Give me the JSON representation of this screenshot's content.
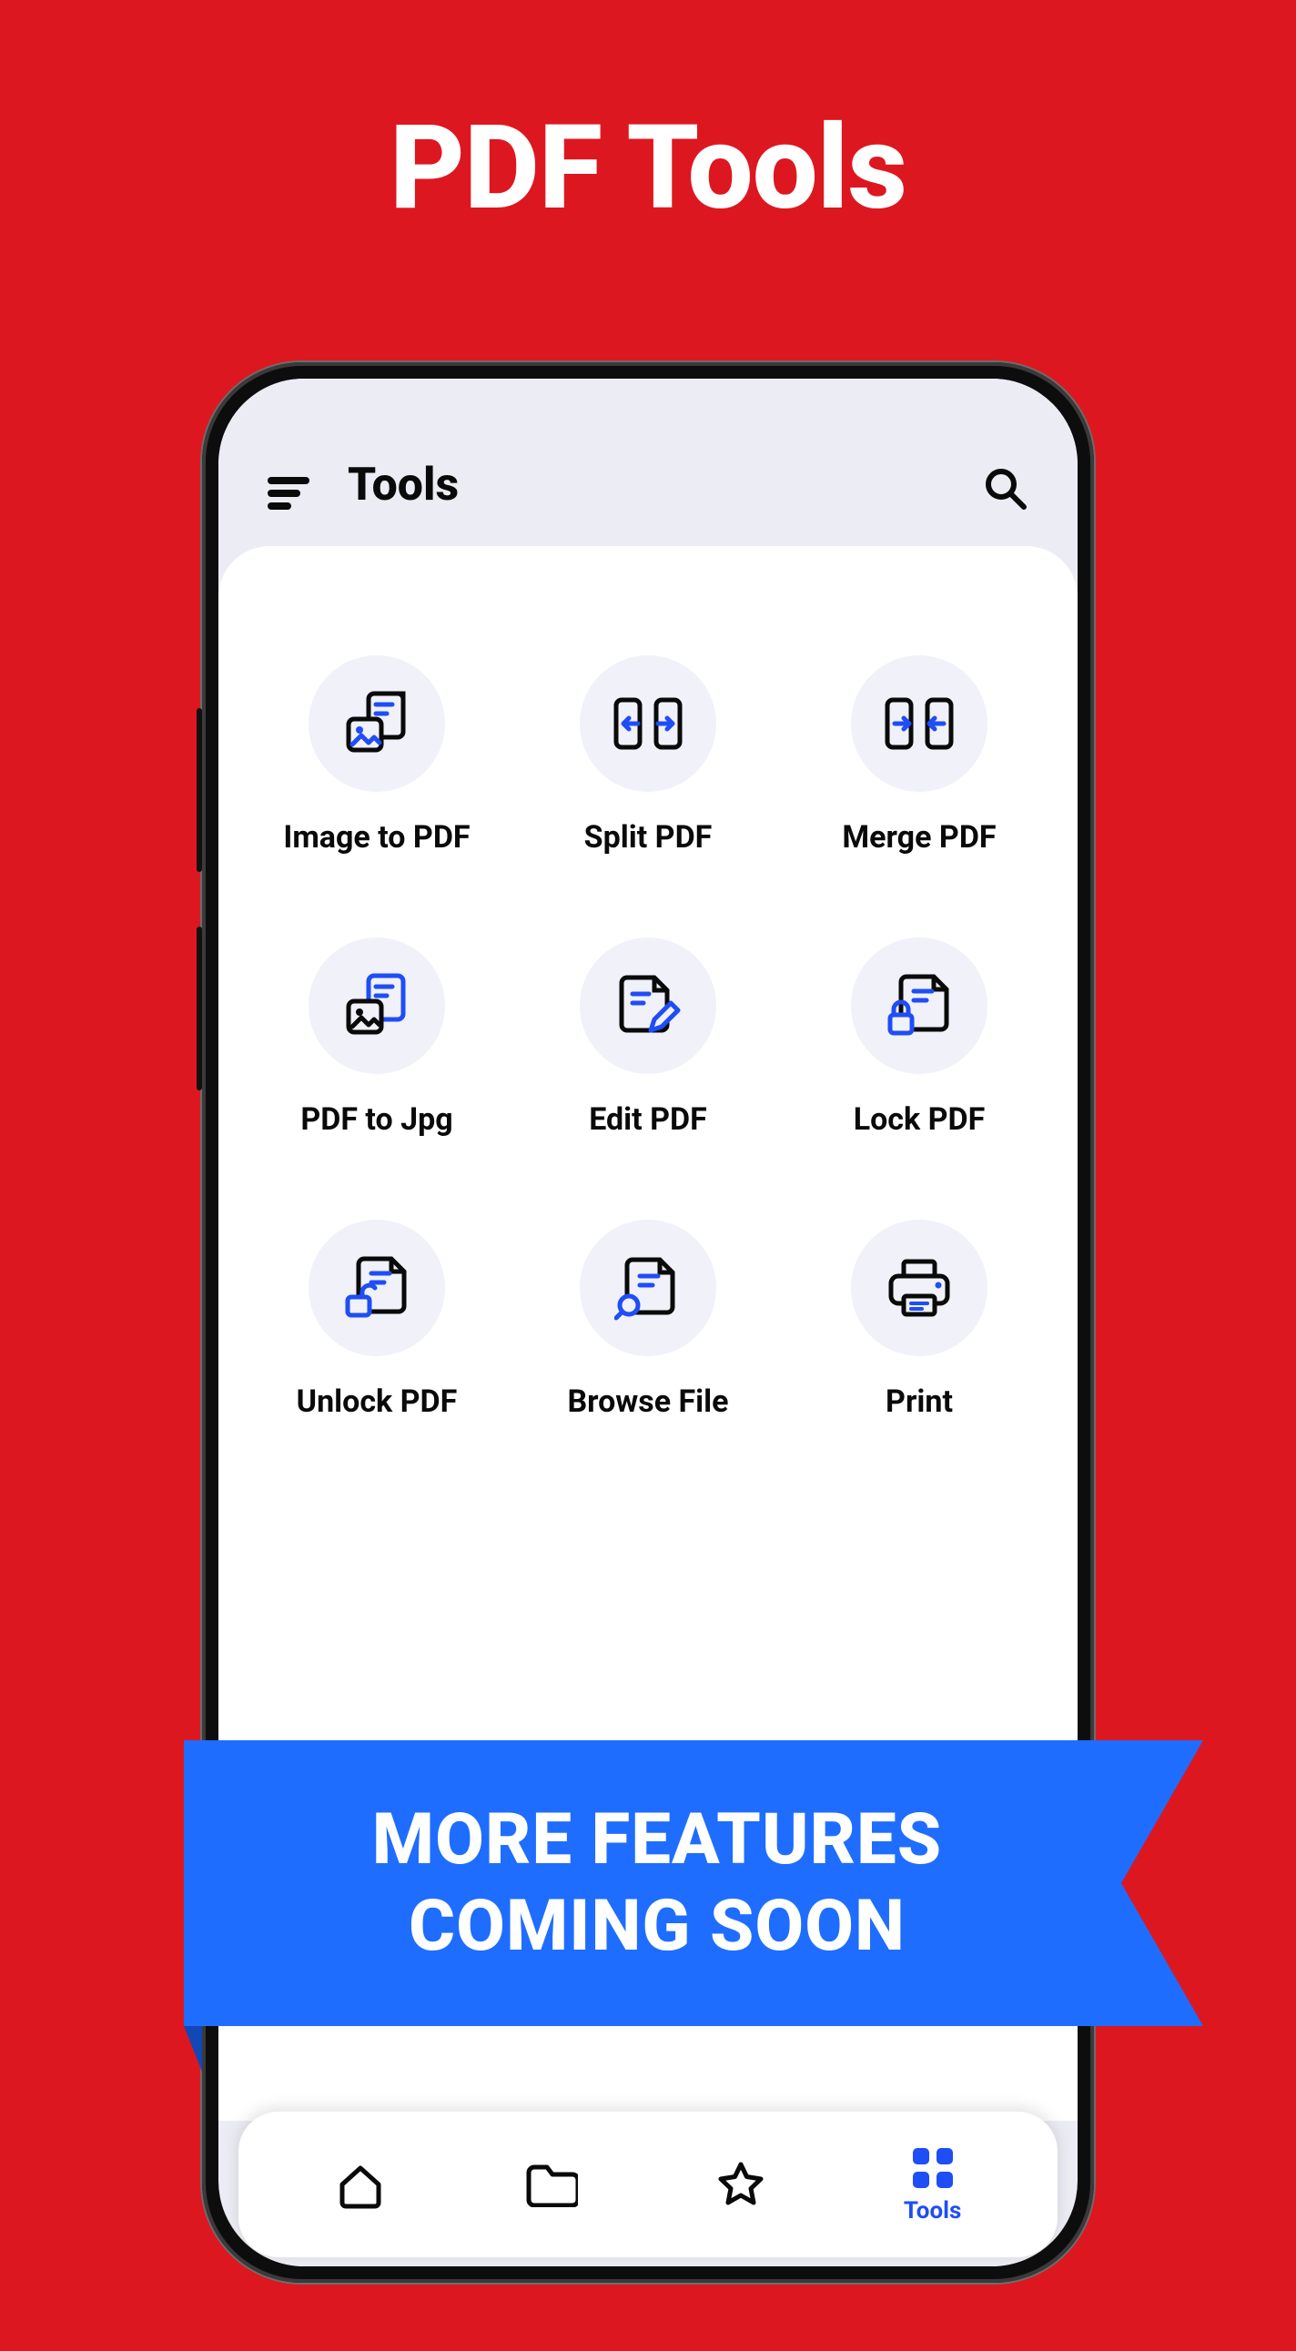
{
  "page": {
    "title": "PDF Tools"
  },
  "appbar": {
    "title": "Tools"
  },
  "tools": [
    {
      "label": "Image to PDF",
      "icon": "image-to-pdf-icon"
    },
    {
      "label": "Split PDF",
      "icon": "split-pdf-icon"
    },
    {
      "label": "Merge PDF",
      "icon": "merge-pdf-icon"
    },
    {
      "label": "PDF to Jpg",
      "icon": "pdf-to-jpg-icon"
    },
    {
      "label": "Edit PDF",
      "icon": "edit-pdf-icon"
    },
    {
      "label": "Lock PDF",
      "icon": "lock-pdf-icon"
    },
    {
      "label": "Unlock PDF",
      "icon": "unlock-pdf-icon"
    },
    {
      "label": "Browse File",
      "icon": "browse-file-icon"
    },
    {
      "label": "Print",
      "icon": "print-icon"
    }
  ],
  "banner": {
    "line1": "MORE FEATURES",
    "line2": "COMING  SOON"
  },
  "nav": {
    "items": [
      {
        "icon": "home-icon",
        "active": false
      },
      {
        "icon": "folder-icon",
        "active": false
      },
      {
        "icon": "star-icon",
        "active": false
      },
      {
        "icon": "tools-icon",
        "active": true,
        "label": "Tools"
      }
    ]
  },
  "colors": {
    "accent": "#1f4df6",
    "banner": "#1f6dff",
    "bg": "#dd1720"
  }
}
